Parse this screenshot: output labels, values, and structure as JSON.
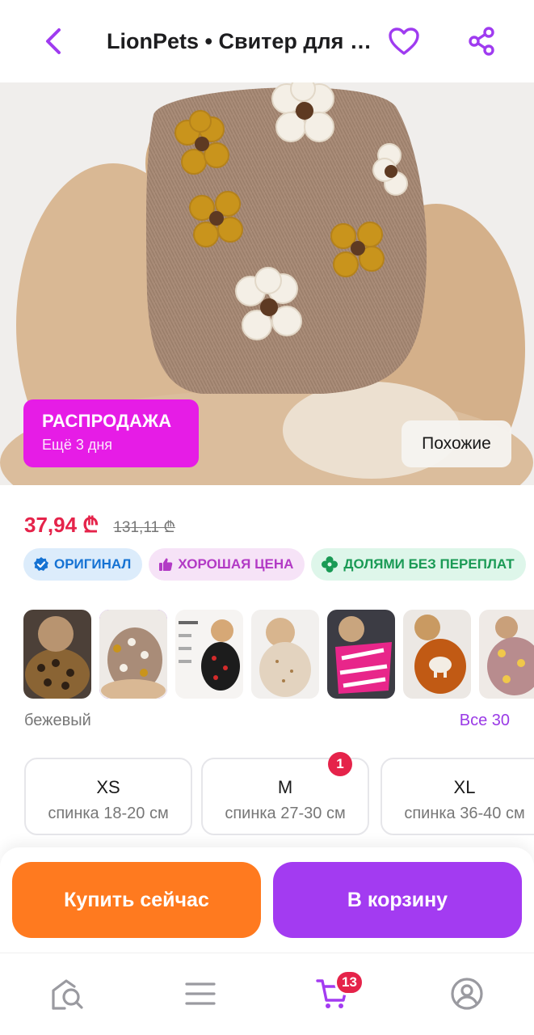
{
  "header": {
    "title": "LionPets • Свитер для с..."
  },
  "hero": {
    "sale_title": "РАСПРОДАЖА",
    "sale_subtitle": "Ещё 3 дня",
    "similar_label": "Похожие"
  },
  "price": {
    "current": "37,94 ₾",
    "old": "131,11 ₾"
  },
  "badges": [
    {
      "label": "ОРИГИНАЛ",
      "icon": "verified-check-icon",
      "color": "#1572d3"
    },
    {
      "label": "ХОРОШАЯ ЦЕНА",
      "icon": "thumbs-up-icon",
      "color": "#b23ac5"
    },
    {
      "label": "ДОЛЯМИ БЕЗ ПЕРЕПЛАТ",
      "icon": "clover-icon",
      "color": "#1a9a55"
    }
  ],
  "variants": {
    "selected_color": "бежевый",
    "all_label": "Все 30"
  },
  "sizes": [
    {
      "name": "XS",
      "desc": "спинка 18-20 см"
    },
    {
      "name": "M",
      "desc": "спинка 27-30 см",
      "badge": "1"
    },
    {
      "name": "XL",
      "desc": "спинка 36-40 см"
    }
  ],
  "actions": {
    "buy_now": "Купить сейчас",
    "add_to_cart": "В корзину"
  },
  "nav": {
    "cart_count": "13"
  },
  "colors": {
    "accent": "#a33bf1",
    "buy": "#ff7a1f",
    "sale": "#e61ce6",
    "price": "#e5234a"
  }
}
